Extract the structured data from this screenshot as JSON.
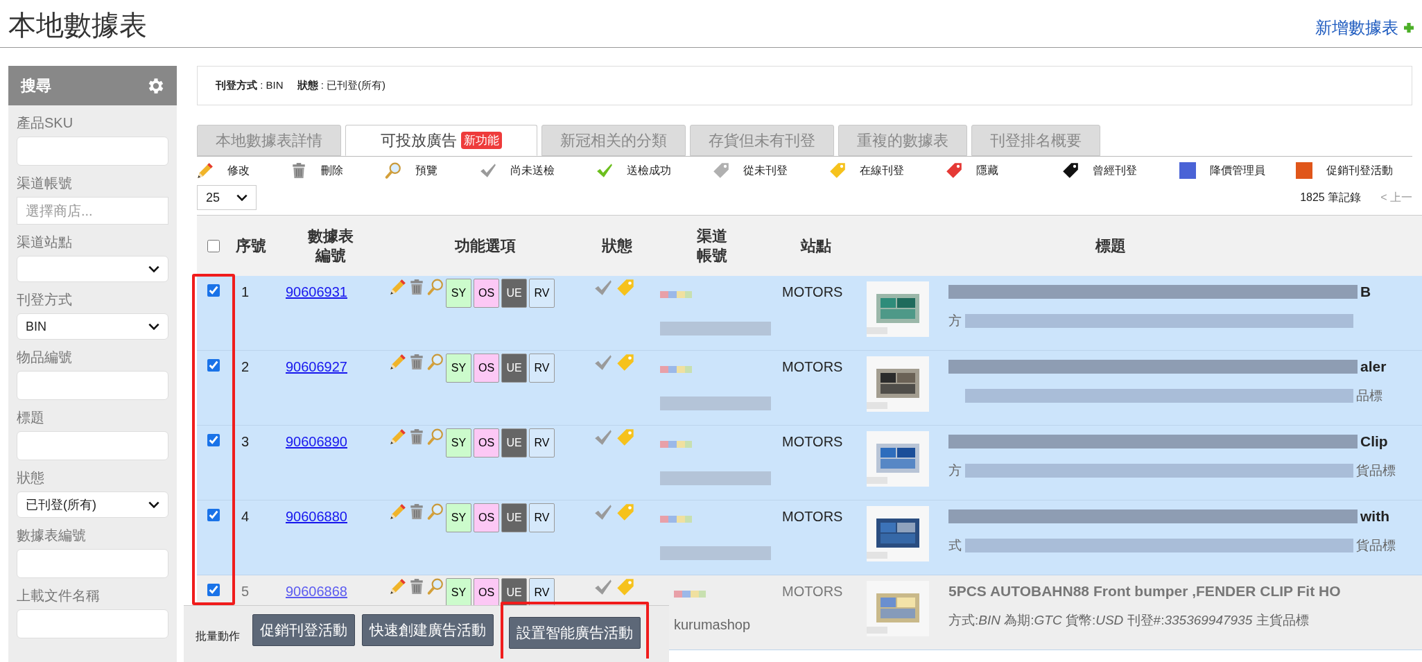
{
  "page_title": "本地數據表",
  "add_link": "新增數據表",
  "sidebar": {
    "title": "搜尋",
    "fields": [
      {
        "label": "產品SKU",
        "kind": "input"
      },
      {
        "label": "渠道帳號",
        "kind": "input",
        "placeholder": "選擇商店..."
      },
      {
        "label": "渠道站點",
        "kind": "select"
      },
      {
        "label": "刊登方式",
        "kind": "select",
        "value": "BIN"
      },
      {
        "label": "物品編號",
        "kind": "input"
      },
      {
        "label": "標題",
        "kind": "input"
      },
      {
        "label": "狀態",
        "kind": "select",
        "value": "已刊登(所有)"
      },
      {
        "label": "數據表編號",
        "kind": "input"
      },
      {
        "label": "上載文件名稱",
        "kind": "input"
      }
    ]
  },
  "filters": [
    {
      "label": "刊登方式",
      "value": ": BIN"
    },
    {
      "label": "狀態",
      "value": ": 已刊登(所有)"
    }
  ],
  "tabs": [
    {
      "label": "本地數據表詳情",
      "selected": false
    },
    {
      "label": "可投放廣告",
      "selected": true,
      "badge": "新功能"
    },
    {
      "label": "新冠相关的分類",
      "selected": false
    },
    {
      "label": "存貨但未有刊登",
      "selected": false
    },
    {
      "label": "重複的數據表",
      "selected": false
    },
    {
      "label": "刊登排名概要",
      "selected": false
    }
  ],
  "legend": [
    {
      "kind": "pencil",
      "label": "修改"
    },
    {
      "kind": "trash",
      "label": "刪除"
    },
    {
      "kind": "magnifier",
      "label": "預覽"
    },
    {
      "kind": "check-gray",
      "label": "尚未送檢"
    },
    {
      "kind": "check-green",
      "label": "送檢成功"
    },
    {
      "kind": "tag-gray",
      "label": "從未刊登"
    },
    {
      "kind": "tag-yellow",
      "label": "在線刊登"
    },
    {
      "kind": "tag-red",
      "label": "隱藏"
    },
    {
      "kind": "tag-black",
      "label": "曾經刊登"
    },
    {
      "kind": "square-blue",
      "label": "降價管理員"
    },
    {
      "kind": "square-orange",
      "label": "促銷刊登活動"
    }
  ],
  "page_size": "25",
  "records": "1825 筆記錄",
  "prev_page": "< 上一",
  "select_all_checked": false,
  "columns": [
    "序號",
    "數據表編號",
    "功能選項",
    "狀態",
    "渠道帳號",
    "站點",
    "標題"
  ],
  "rows": [
    {
      "checked": true,
      "seq": "1",
      "number": "90606931",
      "chips": [
        {
          "label": "SY",
          "kind": "sy"
        },
        {
          "label": "OS",
          "kind": "os"
        },
        {
          "label": "UE",
          "kind": "ue"
        },
        {
          "label": "RV",
          "kind": "rv"
        }
      ],
      "status_icons": [
        {
          "kind": "check-gray"
        },
        {
          "kind": "tag-yellow"
        }
      ],
      "site": "MOTORS",
      "title_tail": "B",
      "meta_head": "方",
      "faded": false
    },
    {
      "checked": true,
      "seq": "2",
      "number": "90606927",
      "chips": [
        {
          "label": "SY",
          "kind": "sy"
        },
        {
          "label": "OS",
          "kind": "os"
        },
        {
          "label": "UE",
          "kind": "ue"
        },
        {
          "label": "RV",
          "kind": "rv"
        }
      ],
      "status_icons": [
        {
          "kind": "check-gray"
        },
        {
          "kind": "tag-yellow"
        }
      ],
      "site": "MOTORS",
      "title_tail": "aler",
      "meta_tail": "品標",
      "faded": false
    },
    {
      "checked": true,
      "seq": "3",
      "number": "90606890",
      "chips": [
        {
          "label": "SY",
          "kind": "sy"
        },
        {
          "label": "OS",
          "kind": "os"
        },
        {
          "label": "UE",
          "kind": "ue"
        },
        {
          "label": "RV",
          "kind": "rv"
        }
      ],
      "status_icons": [
        {
          "kind": "check-gray"
        },
        {
          "kind": "tag-yellow"
        }
      ],
      "site": "MOTORS",
      "title_tail": "Clip",
      "meta_head": "方",
      "meta_tail": "貨品標",
      "faded": false
    },
    {
      "checked": true,
      "seq": "4",
      "number": "90606880",
      "chips": [
        {
          "label": "SY",
          "kind": "sy"
        },
        {
          "label": "OS",
          "kind": "os"
        },
        {
          "label": "UE",
          "kind": "ue"
        },
        {
          "label": "RV",
          "kind": "rv"
        }
      ],
      "status_icons": [
        {
          "kind": "check-gray"
        },
        {
          "kind": "tag-yellow"
        }
      ],
      "site": "MOTORS",
      "title_tail": "with",
      "meta_head": "式",
      "meta_tail": "貨品標",
      "faded": false
    },
    {
      "checked": true,
      "seq": "5",
      "number": "90606868",
      "chips": [
        {
          "label": "SY",
          "kind": "sy"
        },
        {
          "label": "OS",
          "kind": "os"
        },
        {
          "label": "UE",
          "kind": "ue"
        },
        {
          "label": "RV",
          "kind": "rv"
        }
      ],
      "status_icons": [
        {
          "kind": "check-gray"
        },
        {
          "kind": "tag-yellow"
        }
      ],
      "site": "MOTORS",
      "title": "5PCS AUTOBAHN88 Front bumper ,FENDER CLIP Fit HO",
      "meta": "方式:*BIN* 為期:*GTC* 貨幣:*USD* 刊登#:*335369947935* 主貨品標",
      "account": "kurumashop",
      "faded": true
    }
  ],
  "bulk": {
    "label": "批量動作",
    "buttons": [
      "促銷刊登活動",
      "快速創建廣告活動",
      "設置智能廣告活動"
    ]
  }
}
